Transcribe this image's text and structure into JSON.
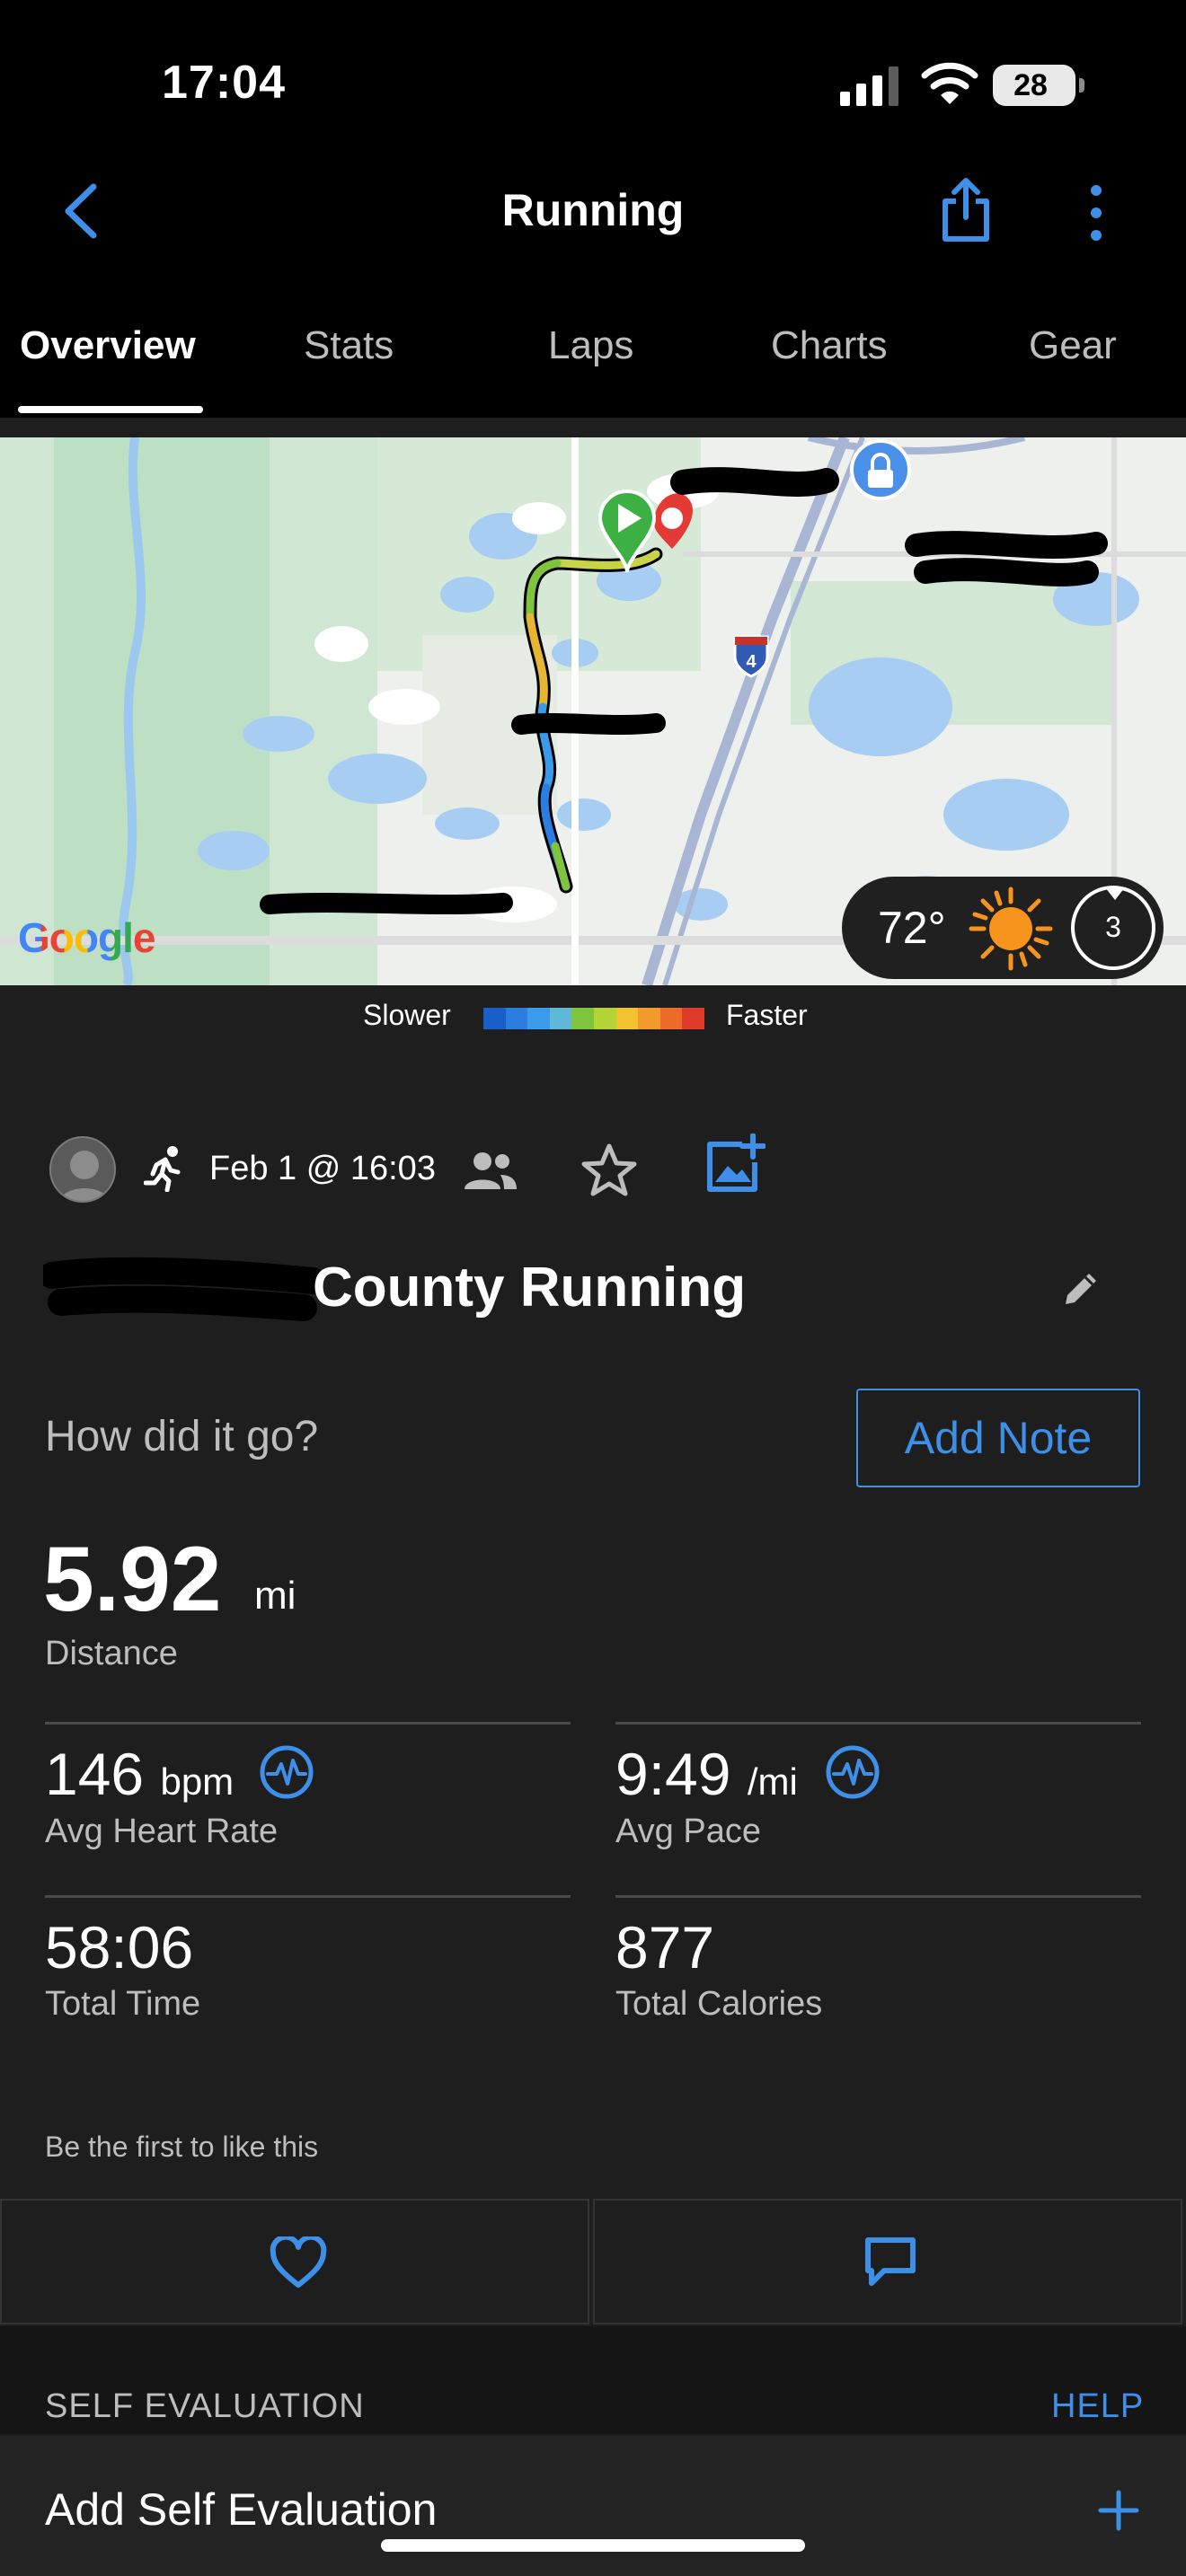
{
  "status_bar": {
    "time": "17:04",
    "battery": "28"
  },
  "header": {
    "title": "Running"
  },
  "tabs": [
    {
      "label": "Overview",
      "active": true
    },
    {
      "label": "Stats",
      "active": false
    },
    {
      "label": "Laps",
      "active": false
    },
    {
      "label": "Charts",
      "active": false
    },
    {
      "label": "Gear",
      "active": false
    }
  ],
  "map": {
    "attribution": "Google",
    "highway_shield": "4",
    "weather": {
      "temperature": "72°",
      "wind": "3"
    }
  },
  "pace_legend": {
    "slower_label": "Slower",
    "faster_label": "Faster",
    "colors": [
      "#1a5fc9",
      "#2b7de0",
      "#3a9bea",
      "#5fb8d8",
      "#7ec43c",
      "#b5d435",
      "#f2c230",
      "#f29a2a",
      "#ec6a2a",
      "#e03a2a"
    ]
  },
  "activity": {
    "date": "Feb 1 @ 16:03",
    "title": "County Running",
    "prompt": "How did it go?",
    "add_note_label": "Add Note",
    "distance": {
      "value": "5.92",
      "unit": "mi",
      "label": "Distance"
    },
    "stats": [
      {
        "value": "146",
        "unit": "bpm",
        "label": "Avg Heart Rate"
      },
      {
        "value": "9:49",
        "unit": "/mi",
        "label": "Avg Pace"
      },
      {
        "value": "58:06",
        "unit": "",
        "label": "Total Time"
      },
      {
        "value": "877",
        "unit": "",
        "label": "Total Calories"
      }
    ],
    "likes_text": "Be the first to like this"
  },
  "self_evaluation": {
    "section_title": "SELF EVALUATION",
    "help_label": "HELP",
    "add_label": "Add Self Evaluation"
  },
  "colors": {
    "accent": "#3d8fe8",
    "background": "#1e1e1f"
  }
}
